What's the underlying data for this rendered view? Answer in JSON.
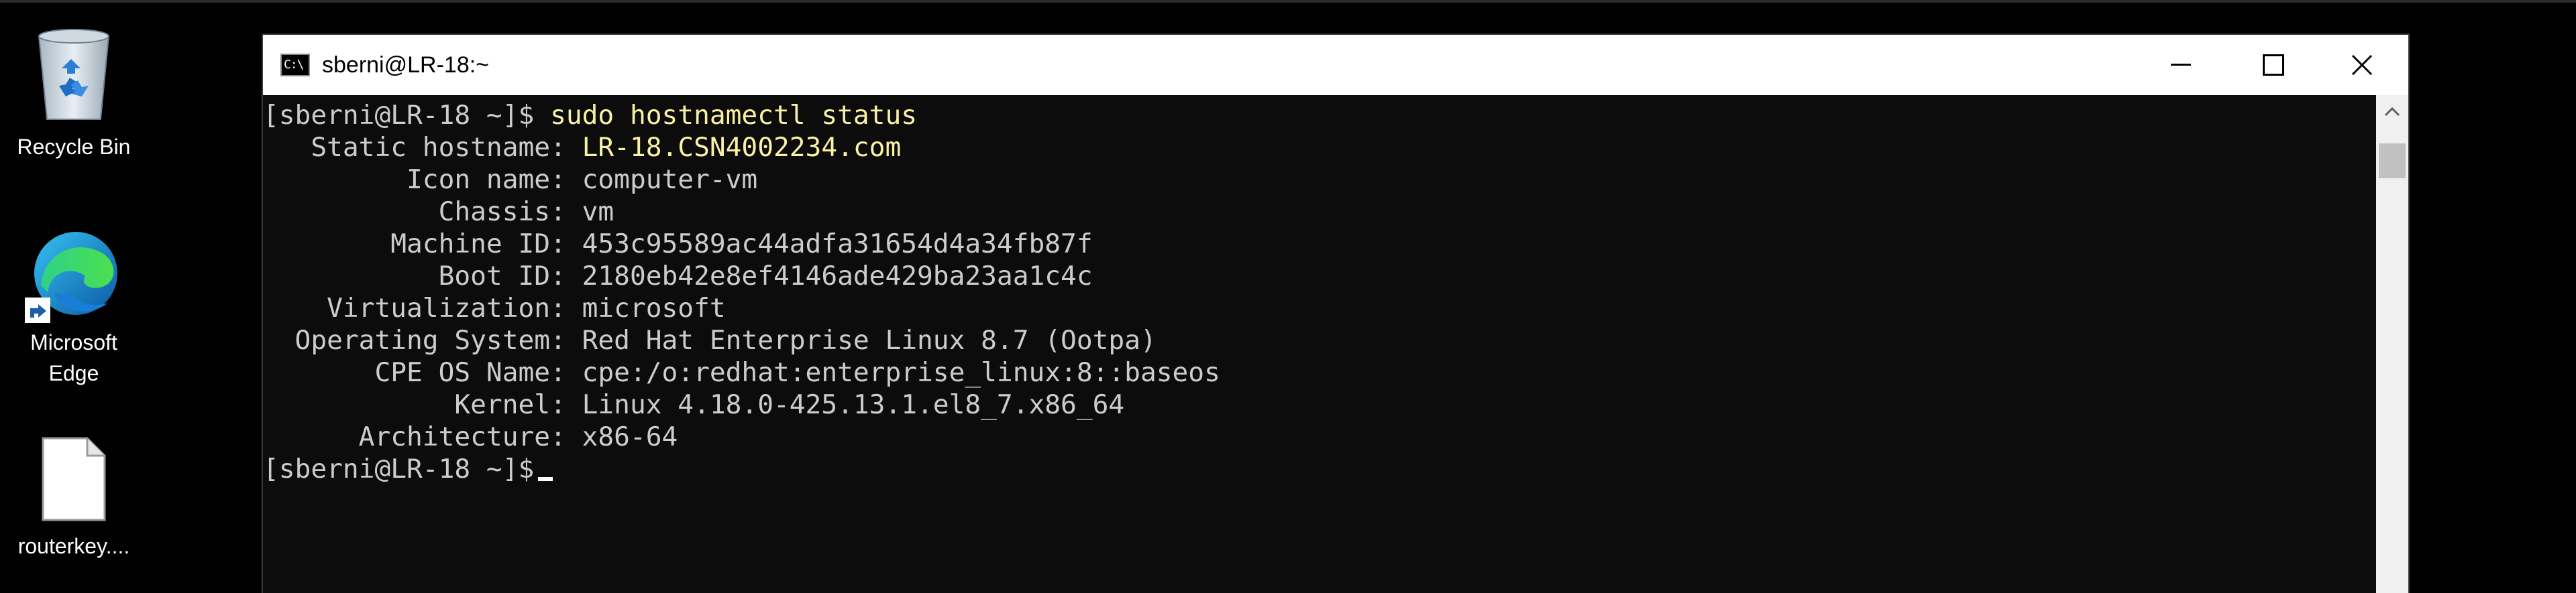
{
  "desktop": {
    "icons": [
      {
        "label": "Recycle Bin",
        "icon": "recycle-bin-icon"
      },
      {
        "label": "Microsoft\nEdge",
        "label_line1": "Microsoft",
        "label_line2": "Edge",
        "icon": "edge-icon"
      },
      {
        "label": "routerkey....",
        "icon": "file-icon"
      }
    ]
  },
  "window": {
    "title": "sberni@LR-18:~",
    "app_icon": "console-icon",
    "controls": {
      "minimize": "minimize-icon",
      "maximize": "maximize-icon",
      "close": "close-icon"
    }
  },
  "terminal": {
    "prompt": "[sberni@LR-18 ~]$ ",
    "command": "sudo hostnamectl status",
    "output": [
      {
        "key": "   Static hostname: ",
        "value": "LR-18.CSN4002234.com",
        "highlight": true
      },
      {
        "key": "         Icon name: ",
        "value": "computer-vm"
      },
      {
        "key": "           Chassis: ",
        "value": "vm"
      },
      {
        "key": "        Machine ID: ",
        "value": "453c95589ac44adfa31654d4a34fb87f"
      },
      {
        "key": "           Boot ID: ",
        "value": "2180eb42e8ef4146ade429ba23aa1c4c"
      },
      {
        "key": "    Virtualization: ",
        "value": "microsoft"
      },
      {
        "key": "  Operating System: ",
        "value": "Red Hat Enterprise Linux 8.7 (Ootpa)"
      },
      {
        "key": "       CPE OS Name: ",
        "value": "cpe:/o:redhat:enterprise_linux:8::baseos"
      },
      {
        "key": "            Kernel: ",
        "value": "Linux 4.18.0-425.13.1.el8_7.x86_64"
      },
      {
        "key": "      Architecture: ",
        "value": "x86-64"
      }
    ],
    "final_prompt": "[sberni@LR-18 ~]$"
  },
  "colors": {
    "console_bg": "#0c0c0c",
    "console_text": "#cccccc",
    "highlight_text": "#f9f1a5",
    "titlebar_bg": "#ffffff"
  }
}
